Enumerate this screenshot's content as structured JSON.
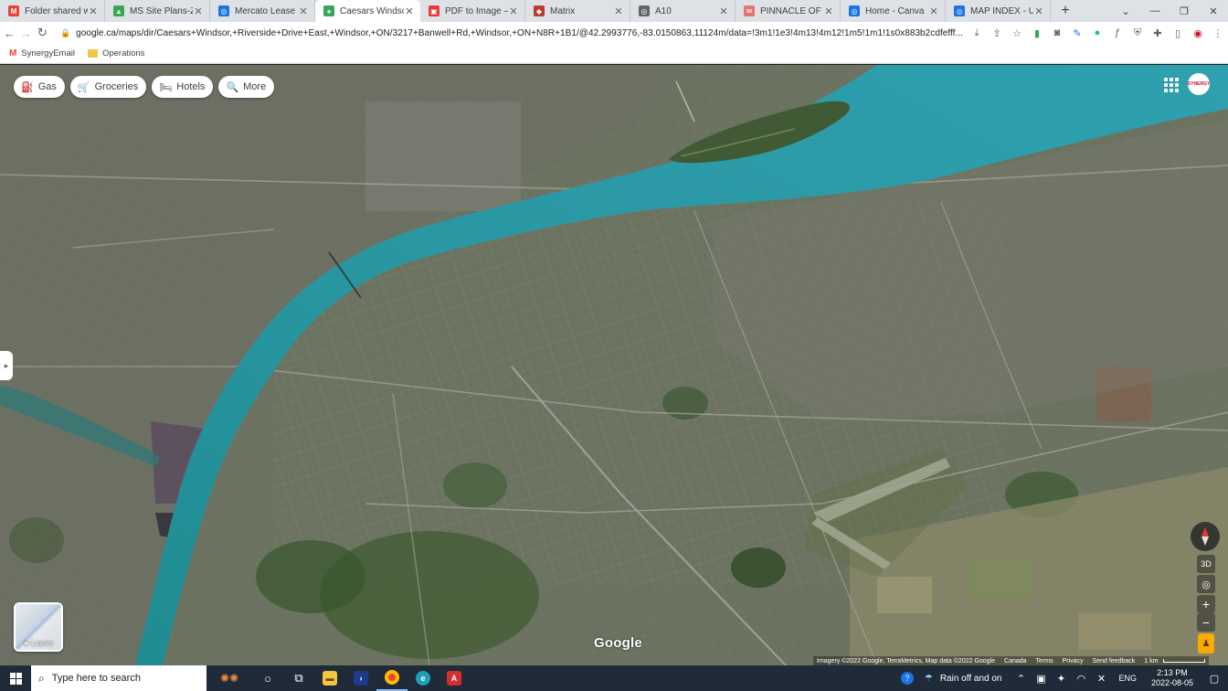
{
  "browser": {
    "tabs": [
      {
        "title": "Folder shared with",
        "favicon": "gmail-icon",
        "color": "#ea4335",
        "glyph": "M"
      },
      {
        "title": "MS Site Plans-Zon",
        "favicon": "drive-icon",
        "color": "#34a853",
        "glyph": "▲"
      },
      {
        "title": "Mercato Lease and",
        "favicon": "globe-icon",
        "color": "#1a73e8",
        "glyph": "◎"
      },
      {
        "title": "Caesars Windsor to",
        "favicon": "maps-pin-icon",
        "color": "#34a853",
        "glyph": "●",
        "active": true
      },
      {
        "title": "PDF to Image – Co",
        "favicon": "pdf-icon",
        "color": "#e53935",
        "glyph": "▣"
      },
      {
        "title": "Matrix",
        "favicon": "matrix-icon",
        "color": "#c0392b",
        "glyph": "◆"
      },
      {
        "title": "A10",
        "favicon": "globe-icon",
        "color": "#5f6368",
        "glyph": "◎"
      },
      {
        "title": "PINNACLE OF LUX",
        "favicon": "mail-icon",
        "color": "#e57373",
        "glyph": "✉"
      },
      {
        "title": "Home - Canva",
        "favicon": "globe-icon",
        "color": "#1a73e8",
        "glyph": "◎"
      },
      {
        "title": "MAP INDEX - US L",
        "favicon": "globe-icon",
        "color": "#1a73e8",
        "glyph": "◎"
      }
    ],
    "new_tab": "+",
    "url": "google.ca/maps/dir/Caesars+Windsor,+Riverside+Drive+East,+Windsor,+ON/3217+Banwell+Rd,+Windsor,+ON+N8R+1B1/@42.2993776,-83.0150863,11124m/data=!3m1!1e3!4m13!4m12!1m5!1m1!1s0x883b2cdfefff...",
    "bookmarks": [
      {
        "label": "SynergyEmail",
        "icon": "gmail-icon"
      },
      {
        "label": "Operations",
        "icon": "folder-icon"
      }
    ]
  },
  "map": {
    "chips": [
      {
        "label": "Gas",
        "icon": "gas-station-icon",
        "glyph": "⛽"
      },
      {
        "label": "Groceries",
        "icon": "cart-icon",
        "glyph": "🛒"
      },
      {
        "label": "Hotels",
        "icon": "bed-icon",
        "glyph": "🛏"
      },
      {
        "label": "More",
        "icon": "search-icon",
        "glyph": "🔍"
      }
    ],
    "layers_label": "Layers",
    "controls": {
      "tilt": "3D",
      "locate": "◎",
      "zoom_in": "+",
      "zoom_out": "−"
    },
    "watermark": "Google",
    "footer": {
      "imagery": "Imagery ©2022 Google, TerraMetrics, Map data ©2022 Google",
      "country": "Canada",
      "terms": "Terms",
      "privacy": "Privacy",
      "feedback": "Send feedback",
      "scale": "1 km"
    },
    "avatar_text": "SYNERGY"
  },
  "taskbar": {
    "search_placeholder": "Type here to search",
    "weather": "Rain off and on",
    "language": "ENG",
    "time": "2:13 PM",
    "date": "2022-08-05"
  }
}
